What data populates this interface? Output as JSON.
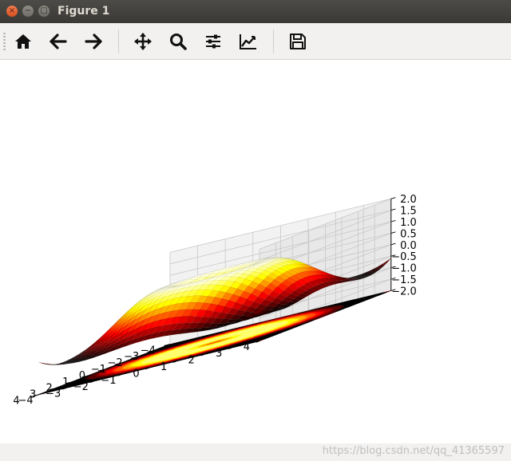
{
  "window": {
    "title": "Figure 1"
  },
  "titlebar_buttons": {
    "close": "×",
    "minimize": "−",
    "maximize": "□"
  },
  "toolbar": {
    "items": [
      {
        "name": "home-button",
        "icon": "home-icon"
      },
      {
        "name": "back-button",
        "icon": "arrow-left-icon"
      },
      {
        "name": "forward-button",
        "icon": "arrow-right-icon"
      },
      {
        "name": "pan-button",
        "icon": "move-icon"
      },
      {
        "name": "zoom-button",
        "icon": "zoom-icon"
      },
      {
        "name": "subplots-button",
        "icon": "sliders-icon"
      },
      {
        "name": "edit-axes-button",
        "icon": "line-chart-icon"
      },
      {
        "name": "save-button",
        "icon": "save-icon"
      }
    ]
  },
  "chart_data": {
    "type": "surface3d",
    "function": "z = sin(sqrt(x^2 + y^2))",
    "colormap": "hot",
    "contour_offset_z": -2,
    "x_range": [
      -4,
      4
    ],
    "y_range": [
      -4,
      4
    ],
    "zlim": [
      -2,
      2
    ],
    "x_ticks": [
      "−4",
      "−3",
      "−2",
      "−1",
      "0",
      "1",
      "2",
      "3",
      "4"
    ],
    "y_ticks": [
      "−4",
      "−3",
      "−2",
      "−1",
      "0",
      "1",
      "2",
      "3",
      "4"
    ],
    "z_ticks": [
      "−2.0",
      "−1.5",
      "−1.0",
      "−0.5",
      "0.0",
      "0.5",
      "1.0",
      "1.5",
      "2.0"
    ],
    "grid": true
  },
  "watermark": "https://blog.csdn.net/qq_41365597"
}
